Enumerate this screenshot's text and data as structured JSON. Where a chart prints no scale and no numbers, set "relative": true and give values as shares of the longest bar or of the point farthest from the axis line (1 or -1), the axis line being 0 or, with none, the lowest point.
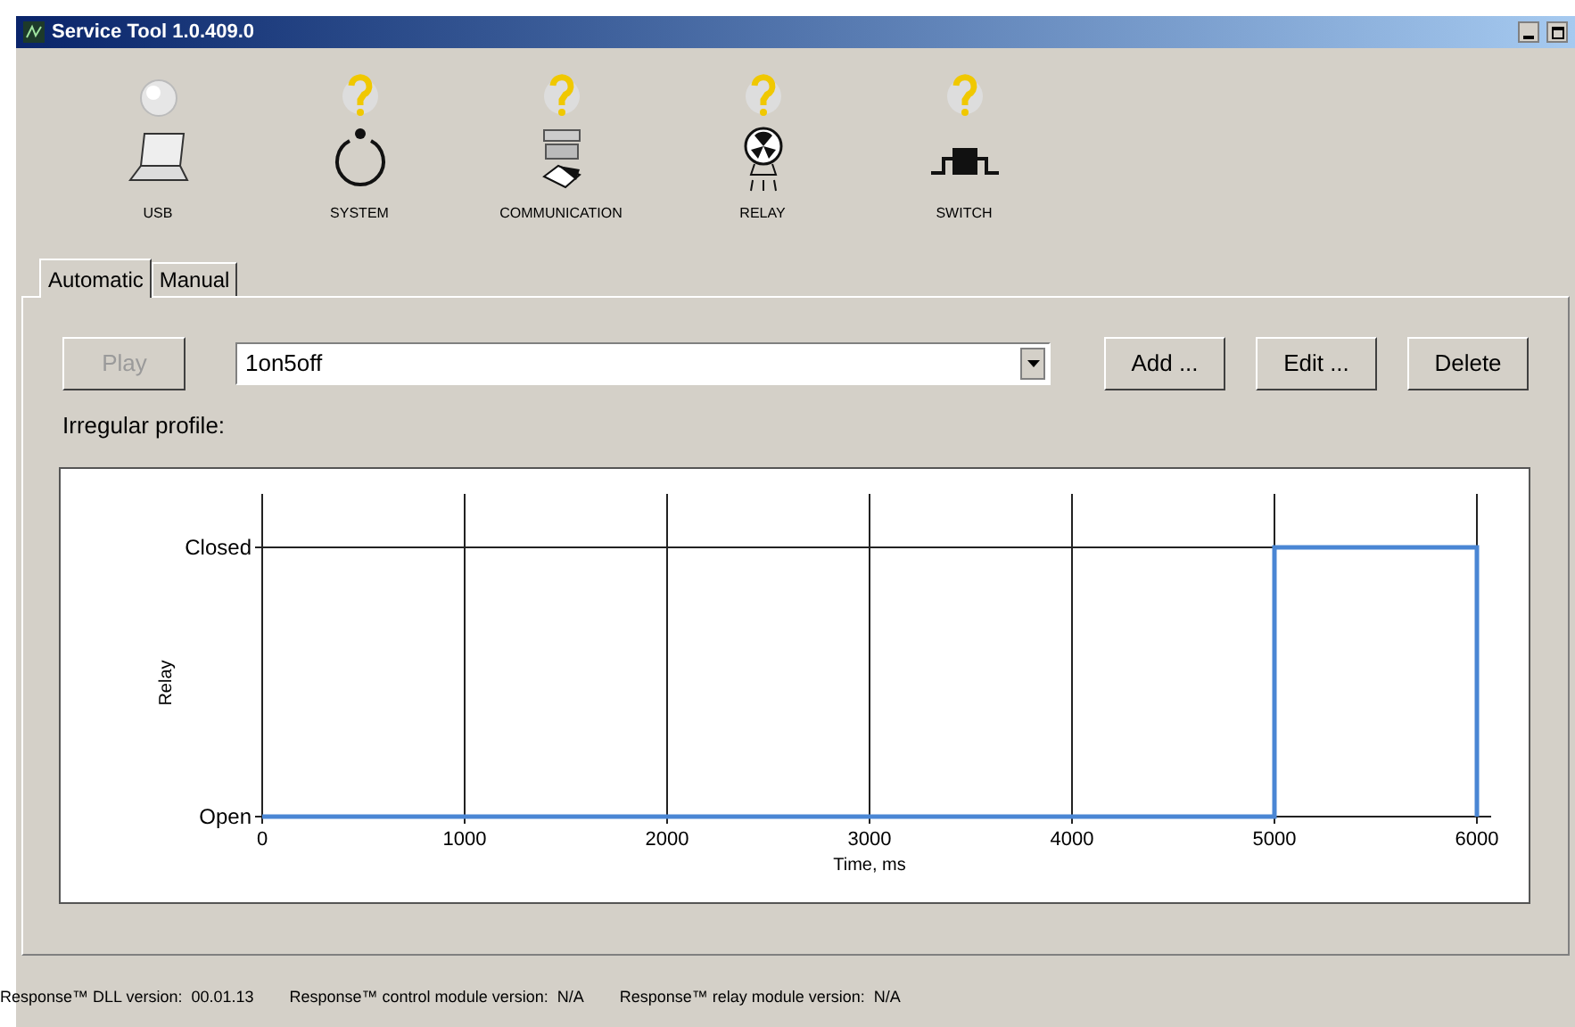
{
  "window": {
    "title": "Service Tool 1.0.409.0"
  },
  "devices": [
    {
      "label": "USB",
      "unknown": false
    },
    {
      "label": "SYSTEM",
      "unknown": true
    },
    {
      "label": "COMMUNICATION",
      "unknown": true
    },
    {
      "label": "RELAY",
      "unknown": true
    },
    {
      "label": "SWITCH",
      "unknown": true
    }
  ],
  "tabs": [
    {
      "label": "Automatic",
      "selected": true
    },
    {
      "label": "Manual",
      "selected": false
    }
  ],
  "play_button": {
    "label": "Play",
    "disabled": true
  },
  "profile_select": {
    "value": "1on5off"
  },
  "buttons": [
    "Add ...",
    "Edit ...",
    "Delete"
  ],
  "profile_label": "Irregular profile:",
  "chart_data": {
    "type": "line",
    "xlabel": "Time, ms",
    "ylabel": "Relay",
    "x": [
      0,
      5000,
      5000,
      6000,
      6000
    ],
    "series": [
      {
        "color": "#4a86d4",
        "values": [
          0,
          0,
          1,
          1,
          0
        ]
      }
    ],
    "xlim": [
      0,
      6000
    ],
    "ylim": [
      0,
      1
    ],
    "xticks": [
      0,
      1000,
      2000,
      3000,
      4000,
      5000,
      6000
    ],
    "annotations": [
      "Closed",
      "Open"
    ],
    "relative": true,
    "grid": true
  },
  "status_bar": [
    "Response™ DLL version:  00.01.13",
    "Response™ control module version:  N/A",
    "Response™ relay module version:  N/A"
  ]
}
